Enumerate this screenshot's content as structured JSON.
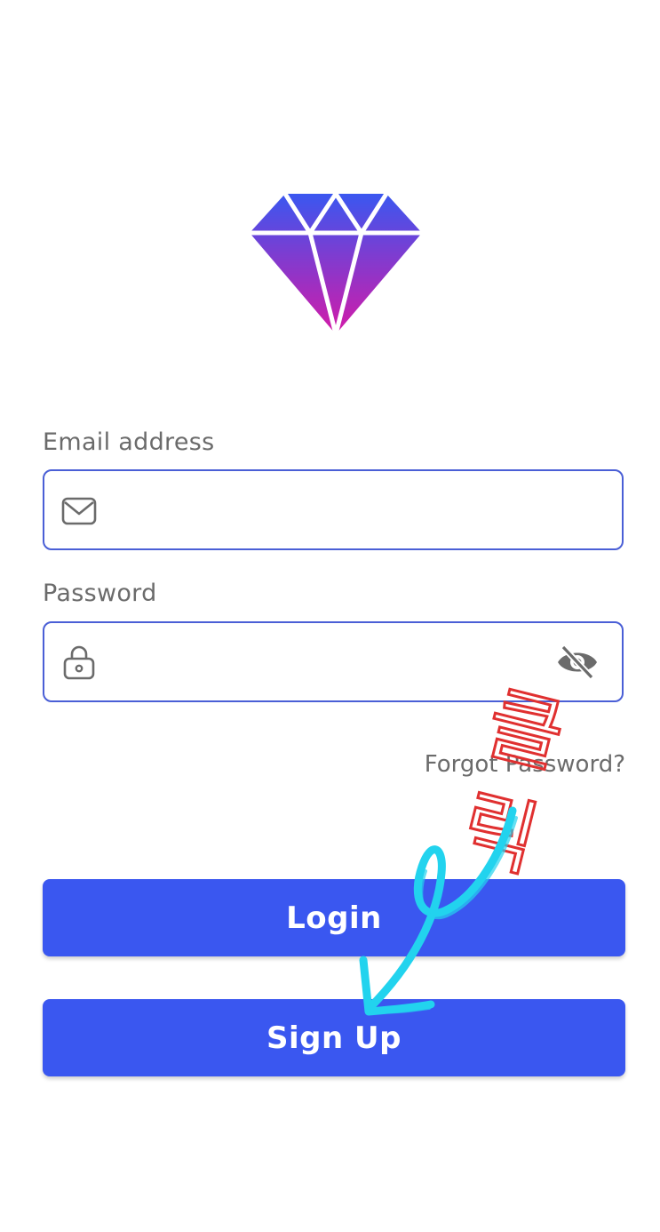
{
  "logo": {
    "icon": "diamond-icon",
    "gradient_top": "#3a57f0",
    "gradient_bottom": "#d41aa8"
  },
  "form": {
    "email": {
      "label": "Email address",
      "value": "",
      "placeholder": "",
      "icon": "envelope-icon"
    },
    "password": {
      "label": "Password",
      "value": "",
      "placeholder": "",
      "icon": "lock-icon",
      "toggle_icon": "eye-off-icon"
    },
    "forgot_label": "Forgot Password?"
  },
  "actions": {
    "login_label": "Login",
    "signup_label": "Sign Up",
    "button_color": "#3a57f0"
  },
  "annotation": {
    "text": "클릭",
    "text_color": "#e03030",
    "arrow_color": "#22d3ee"
  }
}
